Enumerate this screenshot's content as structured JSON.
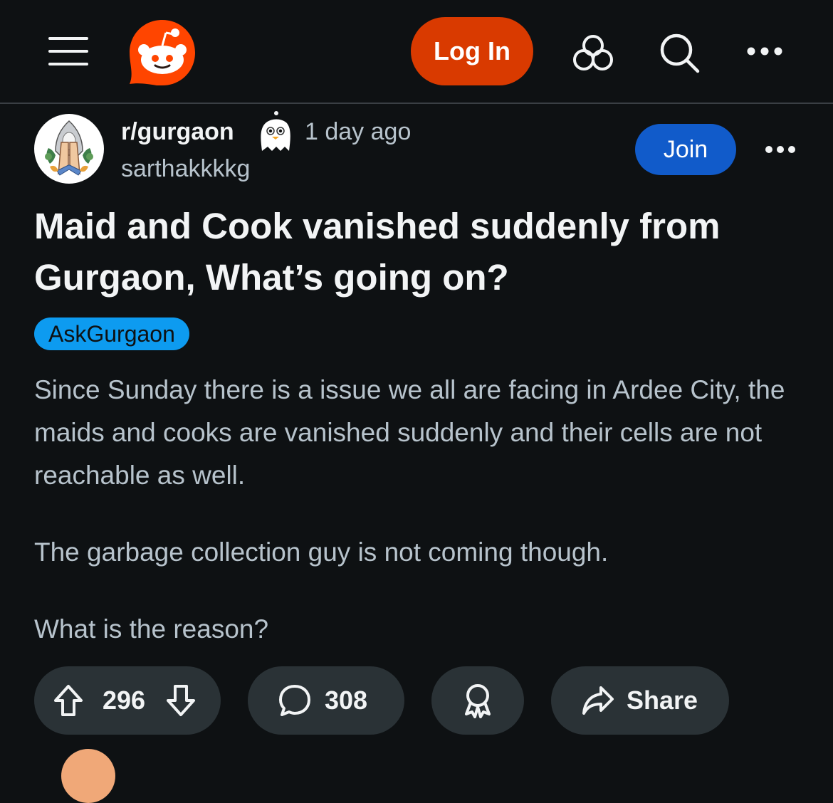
{
  "header": {
    "login_label": "Log In"
  },
  "post": {
    "subreddit": "r/gurgaon",
    "time_ago": "1 day ago",
    "author": "sarthakkkkg",
    "join_label": "Join",
    "title": "Maid and Cook vanished suddenly from Gurgaon, What’s going on?",
    "flair": "AskGurgaon",
    "body": [
      "Since Sunday there is a issue we all are facing in Ardee City, the maids and cooks are vanished suddenly and their cells are not reachable as well.",
      "The garbage collection guy is not coming though.",
      "What is the reason?"
    ]
  },
  "actions": {
    "upvotes": "296",
    "comments": "308",
    "share_label": "Share"
  },
  "colors": {
    "background": "#0e1113",
    "login_accent": "#d93a00",
    "join_accent": "#115bca",
    "flair_bg": "#0d9bf0",
    "pill_bg": "#2a3236"
  },
  "icons": [
    "menu-icon",
    "reddit-logo",
    "explore-icon",
    "search-icon",
    "more-icon",
    "upvote-icon",
    "downvote-icon",
    "comment-icon",
    "award-icon",
    "share-icon"
  ]
}
